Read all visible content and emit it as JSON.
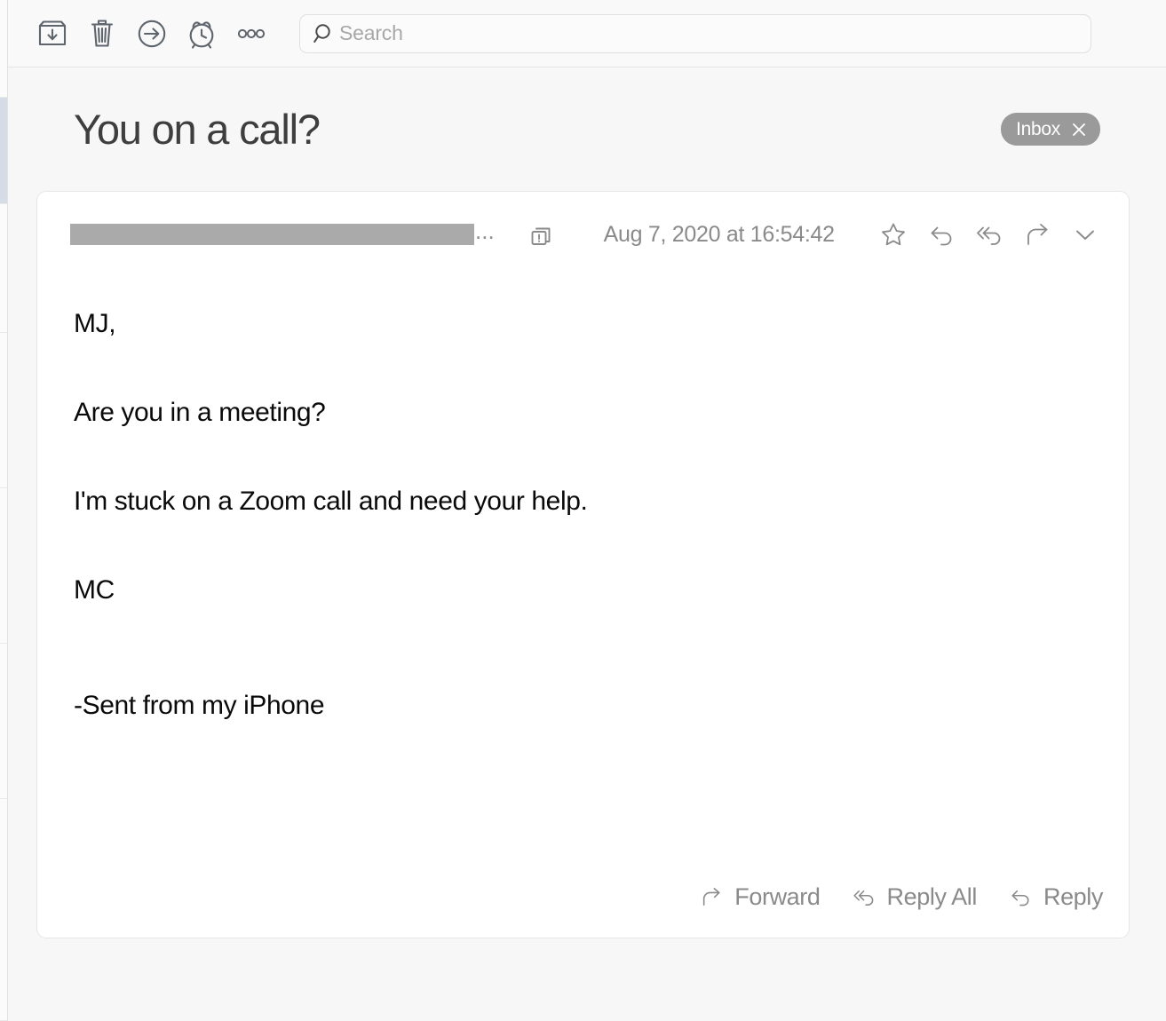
{
  "toolbar": {
    "buttons": [
      {
        "name": "archive",
        "icon": "archive-icon",
        "label": "Archive"
      },
      {
        "name": "delete",
        "icon": "trash-icon",
        "label": "Delete"
      },
      {
        "name": "move",
        "icon": "move-to-icon",
        "label": "Move"
      },
      {
        "name": "snooze",
        "icon": "alarm-clock-icon",
        "label": "Snooze"
      },
      {
        "name": "more",
        "icon": "more-ellipsis-icon",
        "label": "More"
      }
    ],
    "search": {
      "placeholder": "Search",
      "value": "",
      "icon": "search-icon"
    }
  },
  "header": {
    "subject": "You on a call?",
    "mailbox_badge": {
      "label": "Inbox",
      "close_icon": "close-icon"
    }
  },
  "message": {
    "sender_redacted": true,
    "sender_ellipsis": "...",
    "security_icon": "document-alert-icon",
    "date": "Aug 7, 2020 at 16:54:42",
    "actions": [
      {
        "name": "flag",
        "icon": "star-icon"
      },
      {
        "name": "reply",
        "icon": "reply-arrow-icon"
      },
      {
        "name": "reply-all",
        "icon": "reply-all-arrow-icon"
      },
      {
        "name": "forward",
        "icon": "forward-arrow-icon"
      },
      {
        "name": "expand",
        "icon": "chevron-down-icon"
      }
    ],
    "body_lines": [
      "MJ,",
      "Are you in a meeting?",
      "I'm stuck on a Zoom call and need your help.",
      "MC",
      "-Sent from my iPhone"
    ],
    "footer_buttons": [
      {
        "label": "Forward",
        "icon": "forward-arrow-icon"
      },
      {
        "label": "Reply All",
        "icon": "reply-all-arrow-icon"
      },
      {
        "label": "Reply",
        "icon": "reply-arrow-icon"
      }
    ]
  },
  "colors": {
    "window_background": "#f7f7f7",
    "toolbar_background": "#f9f9f9",
    "card_background": "#ffffff",
    "card_border": "#e6e6e6",
    "subject_text": "#3e3e3e",
    "body_text": "#0a0a0a",
    "muted_text": "#8a8a8a",
    "badge_background": "#9a9a9a",
    "redaction": "#aaaaaa",
    "selected_row": "#d6dce5"
  }
}
